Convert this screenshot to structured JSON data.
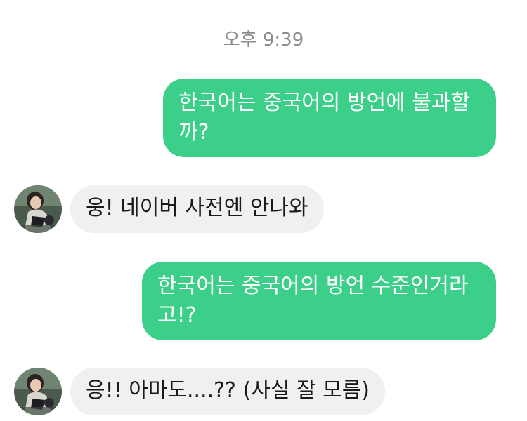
{
  "chat": {
    "timestamp": "오후 9:39",
    "messages": [
      {
        "side": "outgoing",
        "text": "한국어는 중국어의 방언에 불과할\n까?"
      },
      {
        "side": "incoming",
        "text": "웅! 네이버 사전엔 안나와"
      },
      {
        "side": "outgoing",
        "text": "한국어는 중국어의 방언 수준인거라\n고!?"
      },
      {
        "side": "incoming",
        "text": "응!! 아마도....?? (사실 잘 모름)"
      }
    ]
  },
  "colors": {
    "outgoing_bubble": "#3ccf8a",
    "incoming_bubble": "#f0f0f0",
    "timestamp_text": "#8c8c8c"
  }
}
